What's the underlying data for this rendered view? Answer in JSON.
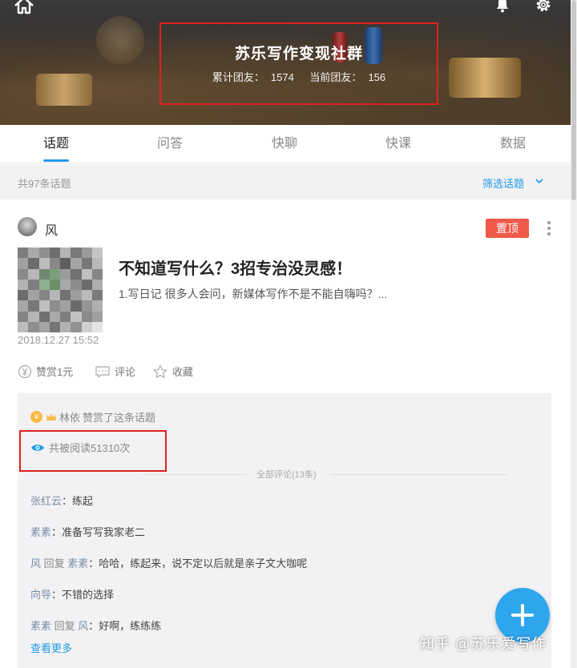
{
  "header": {
    "group_title": "苏乐写作变现社群",
    "total_label": "累计团友：",
    "total_value": "1574",
    "current_label": "当前团友：",
    "current_value": "156"
  },
  "tabs": [
    {
      "label": "话题",
      "active": true
    },
    {
      "label": "问答",
      "active": false
    },
    {
      "label": "快聊",
      "active": false
    },
    {
      "label": "快课",
      "active": false
    },
    {
      "label": "数据",
      "active": false
    }
  ],
  "summary": {
    "count_text": "共97条话题",
    "filter_label": "筛选话题"
  },
  "post": {
    "author": "风",
    "pin_label": "置顶",
    "title": "不知道写什么？3招专治没灵感！",
    "excerpt": "1.写日记 很多人会问，新媒体写作不是不能自嗨吗？...",
    "time": "2018.12.27 15:52",
    "actions": {
      "reward": "赞赏1元",
      "comment": "评论",
      "favorite": "收藏"
    }
  },
  "panel": {
    "reward_name": "林依",
    "reward_text": "赞赏了这条话题",
    "read_text": "共被阅读51310次",
    "all_comments": "全部评论(13条)",
    "comments": [
      {
        "name": "张红云",
        "reply_word": "",
        "target": "",
        "text": "：练起"
      },
      {
        "name": "素素",
        "reply_word": "",
        "target": "",
        "text": "：准备写写我家老二"
      },
      {
        "name": "风",
        "reply_word": " 回复 ",
        "target": "素素",
        "text": "：哈哈，练起来，说不定以后就是亲子文大咖呢"
      },
      {
        "name": "向导",
        "reply_word": "",
        "target": "",
        "text": "：不错的选择"
      },
      {
        "name": "素素",
        "reply_word": " 回复 ",
        "target": "风",
        "text": "：好啊，练练练"
      }
    ],
    "see_more": "查看更多"
  },
  "watermark": "知乎 @苏乐爱写作",
  "colors": {
    "accent": "#1e9be8",
    "pin_red": "#f05a4a",
    "highlight_box": "#e02020",
    "fab_blue": "#2ea6ee"
  },
  "icons": [
    "home-icon",
    "bell-icon",
    "gear-icon",
    "chevron-down-icon",
    "more-icon",
    "yuan-icon",
    "comment-icon",
    "star-icon",
    "coin-icon",
    "crown-icon",
    "eye-icon",
    "plus-icon"
  ]
}
